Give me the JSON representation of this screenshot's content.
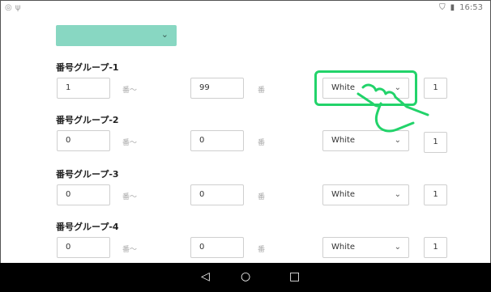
{
  "status_bar": {
    "time": "16:53"
  },
  "top_dropdown": {
    "value": ""
  },
  "groups": [
    {
      "title": "番号グループ-1",
      "from": "1",
      "from_suffix": "番〜",
      "to": "99",
      "to_suffix": "番",
      "color": "White",
      "count": "1"
    },
    {
      "title": "番号グループ-2",
      "from": "0",
      "from_suffix": "番〜",
      "to": "0",
      "to_suffix": "番",
      "color": "White",
      "count": "1"
    },
    {
      "title": "番号グループ-3",
      "from": "0",
      "from_suffix": "番〜",
      "to": "0",
      "to_suffix": "番",
      "color": "White",
      "count": "1"
    },
    {
      "title": "番号グループ-4",
      "from": "0",
      "from_suffix": "番〜",
      "to": "0",
      "to_suffix": "番",
      "color": "White",
      "count": "1"
    }
  ],
  "colors": {
    "accent": "#88d7c2",
    "highlight": "#22d36a"
  },
  "icons": {
    "status_left": [
      "circle-icon",
      "usb-icon"
    ],
    "status_right": [
      "shield-icon",
      "battery-icon"
    ],
    "nav": [
      "back-icon",
      "home-icon",
      "recents-icon"
    ],
    "overlay": "tap-hand-icon"
  }
}
